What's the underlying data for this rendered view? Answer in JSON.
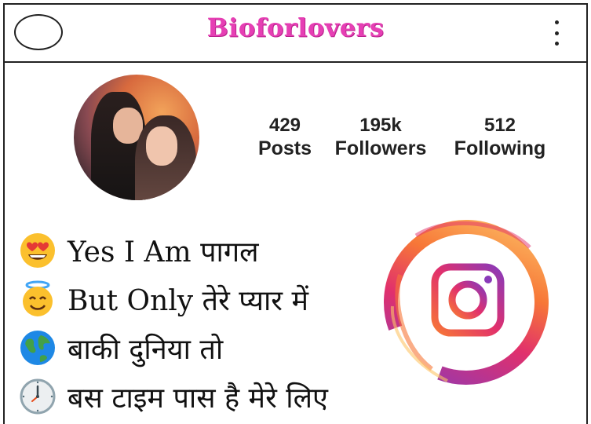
{
  "header": {
    "brand": "Bioforlovers"
  },
  "stats": [
    {
      "value": "429",
      "label": "Posts"
    },
    {
      "value": "195k",
      "label": "Followers"
    },
    {
      "value": "512",
      "label": "Following"
    }
  ],
  "bio": {
    "lines": [
      {
        "emoji": "heart-eyes-emoji",
        "text": "Yes I Am पागल"
      },
      {
        "emoji": "halo-smile-emoji",
        "text": "But Only तेरे प्यार में"
      },
      {
        "emoji": "globe-emoji",
        "text": "बाकी दुनिया तो"
      },
      {
        "emoji": "clock-emoji",
        "text": "बस टाइम पास है मेरे लिए"
      }
    ]
  },
  "colors": {
    "brand": "#e63fb4",
    "ig_purple": "#8a3ab9",
    "ig_pink": "#e1306c",
    "ig_orange": "#f77737"
  }
}
